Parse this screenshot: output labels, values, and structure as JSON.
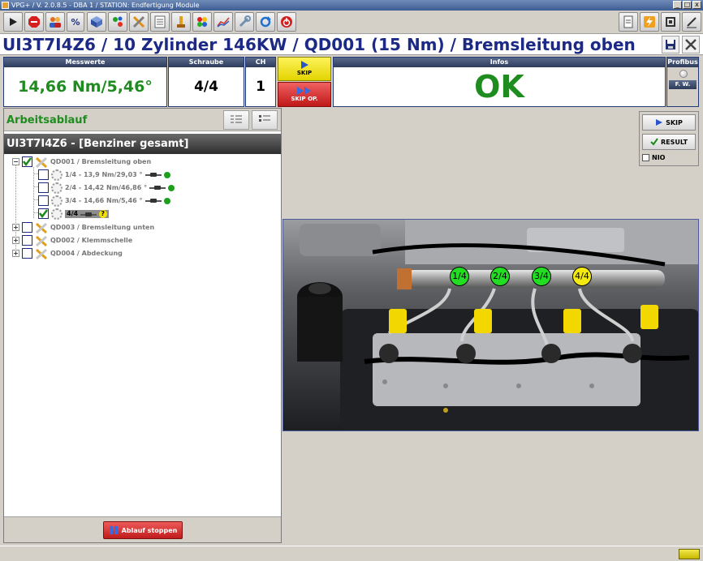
{
  "window": {
    "title": "VPG+ / V. 2.0.8.5 - DBA 1 / STATION: Endfertigung Module",
    "controls": [
      "_",
      "□",
      "x"
    ]
  },
  "toolbar": {
    "icons": [
      "play-icon",
      "stop-icon",
      "users-icon",
      "percent-icon",
      "cube-icon",
      "network-icon",
      "tools-icon",
      "list-icon",
      "torque-icon",
      "traffic-light-icon",
      "chart-icon",
      "wrench-icon",
      "refresh-icon",
      "power-icon",
      "document-icon",
      "flash-icon",
      "exit-icon",
      "edit-icon"
    ],
    "percent_label": "%"
  },
  "header": {
    "title": "UI3T7I4Z6 / 10 Zylinder 146KW / QD001 (15 Nm) / Bremsleitung oben"
  },
  "status": {
    "messwerte_label": "Messwerte",
    "messwerte_value": "14,66 Nm/5,46°",
    "schraube_label": "Schraube",
    "schraube_value": "4/4",
    "ch_label": "CH",
    "ch_value": "1",
    "skip_label": "SKIP",
    "skip_op_label": "SKIP OP.",
    "infos_label": "Infos",
    "infos_value": "OK",
    "profibus_label": "Profibus",
    "fw_label": "F. W."
  },
  "left_panel": {
    "title": "Arbeitsablauf",
    "group": "UI3T7I4Z6 - [Benziner gesamt]",
    "tree": [
      {
        "label": "QD001 / Bremsleitung oben",
        "expanded": true,
        "checked": true,
        "children": [
          {
            "label": "1/4 - 13,9 Nm/29,03 °",
            "checked": false,
            "state": "done"
          },
          {
            "label": "2/4 - 14,42 Nm/46,86 °",
            "checked": false,
            "state": "done"
          },
          {
            "label": "3/4 - 14,66 Nm/5,46 °",
            "checked": false,
            "state": "done"
          },
          {
            "label": "4/4",
            "checked": true,
            "state": "current"
          }
        ]
      },
      {
        "label": "QD003 / Bremsleitung unten",
        "expanded": false,
        "checked": false
      },
      {
        "label": "QD002 / Klemmschelle",
        "expanded": false,
        "checked": false
      },
      {
        "label": "QD004 / Abdeckung",
        "expanded": false,
        "checked": false
      }
    ],
    "current_marker": "?",
    "stop_button": "Ablauf stoppen"
  },
  "right_panel": {
    "skip_label": "SKIP",
    "result_label": "RESULT",
    "nio_label": "NIO"
  },
  "photo": {
    "markers": [
      {
        "label": "1/4",
        "color": "#22dd22"
      },
      {
        "label": "2/4",
        "color": "#22dd22"
      },
      {
        "label": "3/4",
        "color": "#22dd22"
      },
      {
        "label": "4/4",
        "color": "#f2ea10"
      }
    ]
  },
  "colors": {
    "title_blue": "#1c2a86",
    "ok_green": "#1e8c1e",
    "skip_yellow": "#f2e60e",
    "skip_red": "#d82424"
  }
}
